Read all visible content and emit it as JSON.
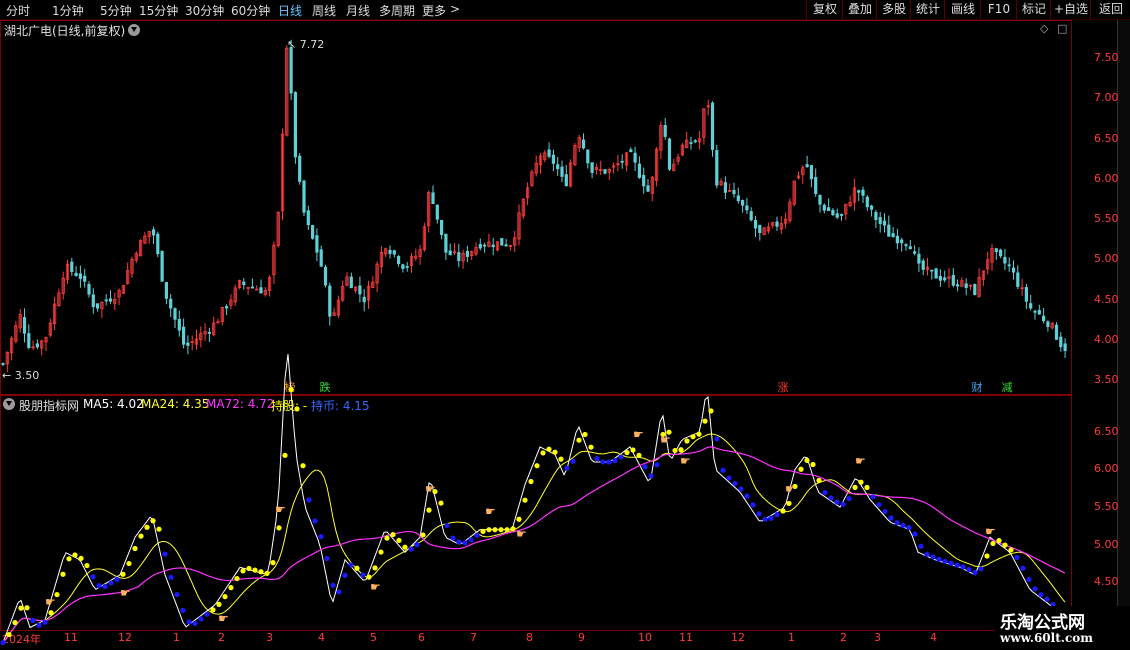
{
  "toolbar": {
    "periods": [
      "分时",
      "1分钟",
      "5分钟",
      "15分钟",
      "30分钟",
      "60分钟",
      "日线",
      "周线",
      "月线",
      "多周期",
      "更多"
    ],
    "active_period": "日线",
    "more_arrow": ">",
    "right_buttons": [
      "复权",
      "叠加",
      "多股",
      "统计",
      "画线",
      "F10",
      "标记",
      "+自选",
      "返回"
    ]
  },
  "main_panel": {
    "title": "湖北广电(日线,前复权)",
    "high_label": "7.72",
    "low_label": "3.50",
    "y_ticks": [
      "7.50",
      "7.00",
      "6.50",
      "6.00",
      "5.50",
      "5.00",
      "4.50",
      "4.00",
      "3.50"
    ],
    "signals": [
      {
        "text": "榜",
        "color": "#ff8c00"
      },
      {
        "text": "跌",
        "color": "#33dd33"
      },
      {
        "text": "涨",
        "color": "#ff3333"
      },
      {
        "text": "财",
        "color": "#3fa9ff"
      },
      {
        "text": "减",
        "color": "#33dd33"
      }
    ]
  },
  "indicator_panel": {
    "name": "股朋指标网",
    "ma5": "MA5: 4.02",
    "ma24": "MA24: 4.35",
    "ma72": "MA72: 4.72",
    "hold": "持股: -",
    "coin": "持币: 4.15",
    "y_ticks": [
      "6.50",
      "6.00",
      "5.50",
      "5.00",
      "4.50",
      "4.00"
    ],
    "colors": {
      "ma5": "#ffffff",
      "ma24": "#ffff33",
      "ma72": "#ff33ff",
      "hold": "#ffff00",
      "coin": "#0000ff"
    }
  },
  "x_axis": [
    "2024年",
    "11",
    "12",
    "1",
    "2",
    "3",
    "4",
    "5",
    "6",
    "7",
    "8",
    "9",
    "10",
    "11",
    "12",
    "1",
    "2",
    "3",
    "4"
  ],
  "watermark": {
    "title": "乐淘公式网",
    "url": "www.60lt.com"
  },
  "price_range": {
    "min": 3.35,
    "max": 7.95
  },
  "indicator_range": {
    "min": 3.92,
    "max": 6.95
  }
}
